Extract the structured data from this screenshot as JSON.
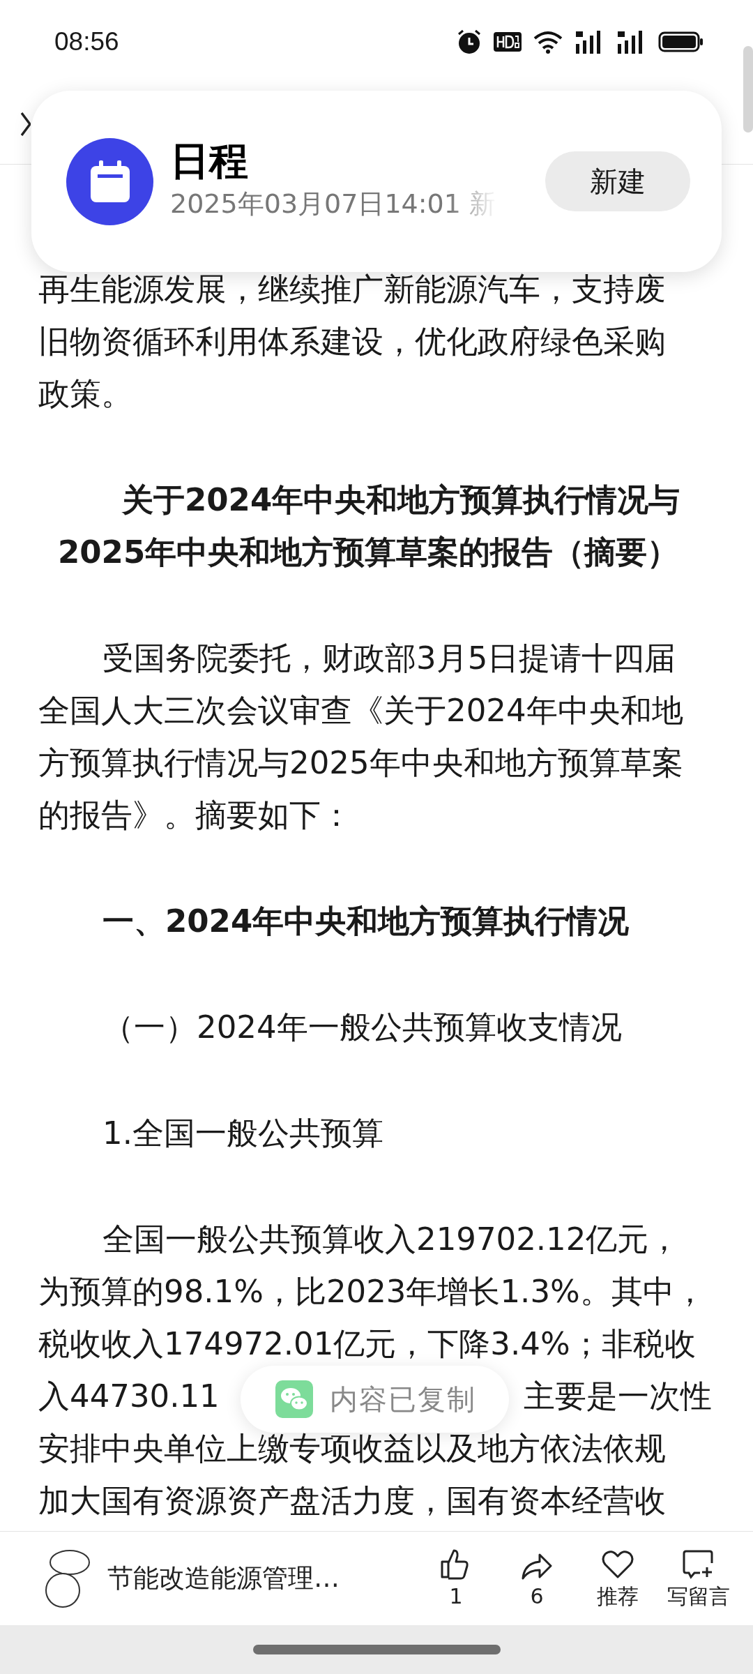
{
  "status_bar": {
    "time": "08:56"
  },
  "notification": {
    "title": "日程",
    "subtitle": "2025年03月07日14:01 新",
    "button": "新建"
  },
  "article": {
    "blocks": [
      {
        "kind": "continuation",
        "lines": [
          "再生能源发展，继续推广新能源汽车，支持废",
          "旧物资循环利用体系建设，优化政府绿色采购",
          "政策。"
        ]
      },
      {
        "kind": "title",
        "lines": [
          "关于2024年中央和地方预算执行情况与",
          "2025年中央和地方预算草案的报告（摘要）"
        ]
      },
      {
        "kind": "paragraph",
        "lines": [
          "受国务院委托，财政部3月5日提请十四届",
          "全国人大三次会议审查《关于2024年中央和地",
          "方预算执行情况与2025年中央和地方预算草案",
          "的报告》。摘要如下："
        ]
      },
      {
        "kind": "heading",
        "lines": [
          "一、2024年中央和地方预算执行情况"
        ]
      },
      {
        "kind": "subheading",
        "lines": [
          "（一）2024年一般公共预算收支情况"
        ]
      },
      {
        "kind": "subheading",
        "lines": [
          "1.全国一般公共预算"
        ]
      },
      {
        "kind": "paragraph",
        "lines": [
          "全国一般公共预算收入219702.12亿元，",
          "为预算的98.1%，比2023年增长1.3%。其中，",
          "税收收入174972.01亿元，下降3.4%；非税收",
          [
            "入44730.11",
            "主要是一次性"
          ],
          "安排中央单位上缴专项收益以及地方依法依规",
          "加大国有资源资产盘活力度，国有资本经营收"
        ]
      }
    ]
  },
  "toast": {
    "text": "内容已复制"
  },
  "bottom_bar": {
    "author": "节能改造能源管理…",
    "actions": [
      {
        "kind": "like",
        "label": "1"
      },
      {
        "kind": "share",
        "label": "6"
      },
      {
        "kind": "recommend",
        "label": "推荐"
      },
      {
        "kind": "comment",
        "label": "写留言"
      }
    ]
  }
}
